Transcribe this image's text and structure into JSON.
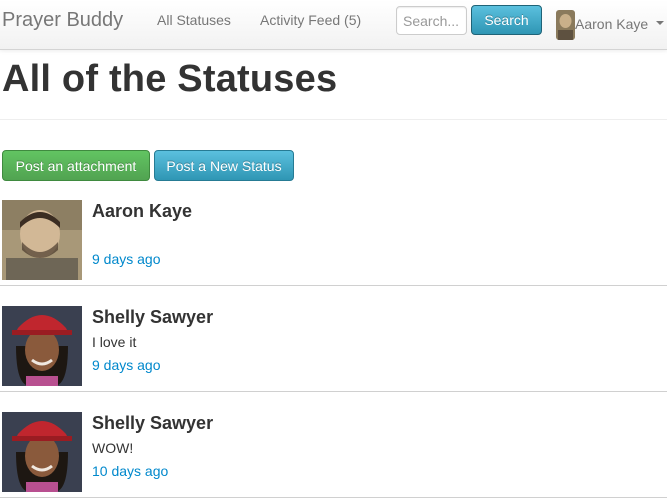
{
  "navbar": {
    "brand": "Prayer Buddy",
    "links": [
      "All Statuses",
      "Activity Feed (5)"
    ],
    "search": {
      "placeholder": "Search...",
      "button_label": "Search"
    },
    "user": {
      "name": "Aaron Kaye"
    }
  },
  "page": {
    "title": "All of the Statuses",
    "actions": {
      "attachment_label": "Post an attachment",
      "status_label": "Post a New Status"
    }
  },
  "statuses": [
    {
      "author": "Aaron Kaye",
      "text": "",
      "time": "9 days ago"
    },
    {
      "author": "Shelly Sawyer",
      "text": "I love it",
      "time": "9 days ago"
    },
    {
      "author": "Shelly Sawyer",
      "text": "WOW!",
      "time": "10 days ago"
    }
  ],
  "colors": {
    "link": "#0088cc",
    "success": "#5bb75b",
    "info": "#49afcd"
  }
}
